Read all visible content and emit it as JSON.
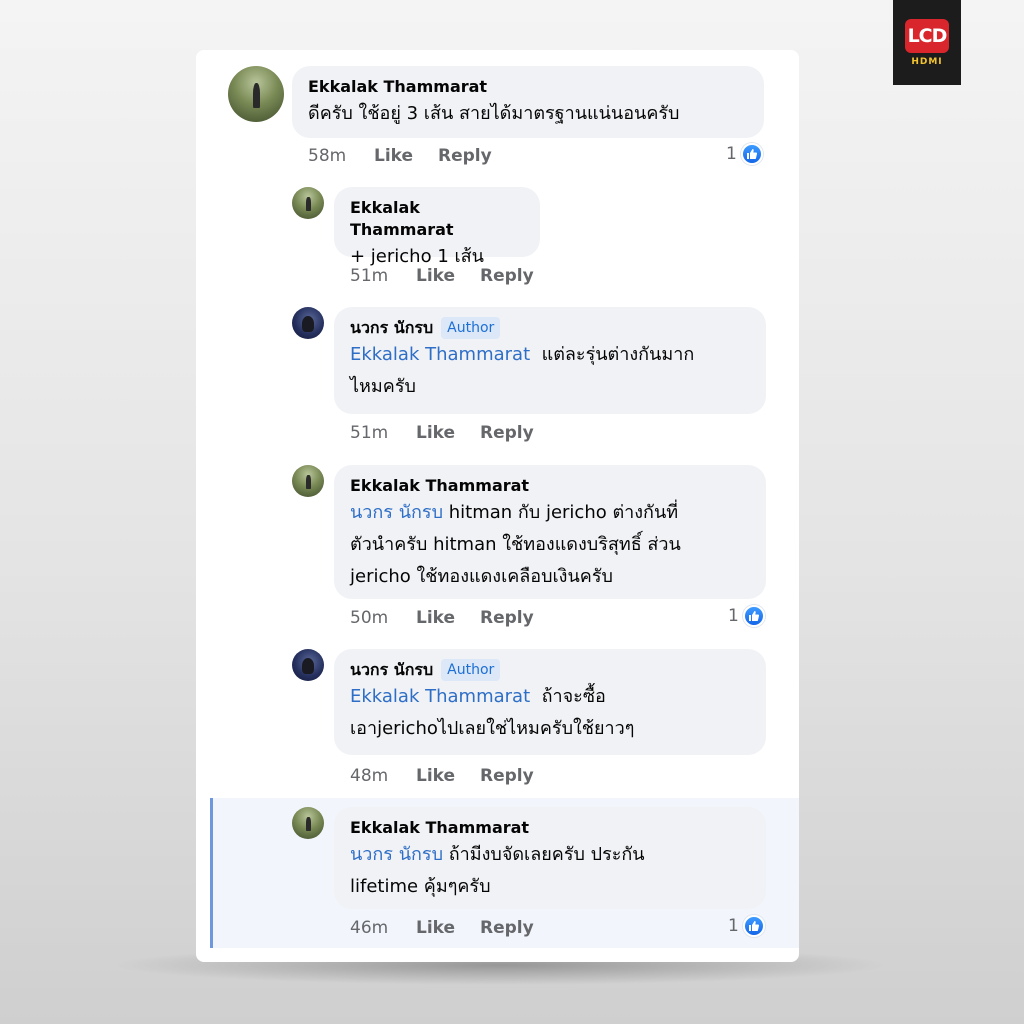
{
  "logo": {
    "mark": "LCD",
    "sub": "HDMI"
  },
  "comments": [
    {
      "name": "Ekkalak Thammarat",
      "text": "ดีครับ ใช้อยู่ 3 เส้น สายได้มาตรฐานแน่นอนครับ",
      "time": "58m",
      "like": "Like",
      "reply": "Reply",
      "reactions": "1"
    },
    {
      "name": "Ekkalak Thammarat",
      "text": "+ jericho 1 เส้น",
      "time": "51m",
      "like": "Like",
      "reply": "Reply"
    },
    {
      "name": "นวกร นักรบ",
      "badge": "Author",
      "mention": "Ekkalak Thammarat",
      "line1": "แต่ละรุ่นต่างกันมาก",
      "line2": "ไหมครับ",
      "time": "51m",
      "like": "Like",
      "reply": "Reply"
    },
    {
      "name": "Ekkalak Thammarat",
      "mention": "นวกร นักรบ",
      "line1": "hitman กับ jericho ต่างกันที่",
      "line2": "ตัวนำครับ hitman ใช้ทองแดงบริสุทธิ์ ส่วน",
      "line3": "jericho ใช้ทองแดงเคลือบเงินครับ",
      "time": "50m",
      "like": "Like",
      "reply": "Reply",
      "reactions": "1"
    },
    {
      "name": "นวกร นักรบ",
      "badge": "Author",
      "mention": "Ekkalak Thammarat",
      "line1": "ถ้าจะซื้อ",
      "line2": "เอาjerichoไปเลยใช่ไหมครับใช้ยาวๆ",
      "time": "48m",
      "like": "Like",
      "reply": "Reply"
    },
    {
      "name": "Ekkalak Thammarat",
      "mention": "นวกร นักรบ",
      "line1": "ถ้ามีงบจัดเลยครับ ประกัน",
      "line2": "lifetime คุ้มๆครับ",
      "time": "46m",
      "like": "Like",
      "reply": "Reply",
      "reactions": "1"
    }
  ]
}
